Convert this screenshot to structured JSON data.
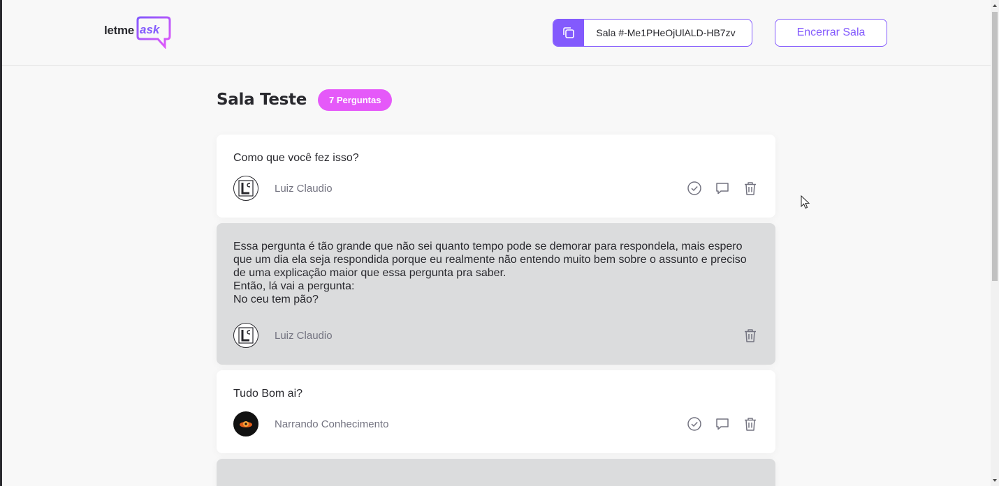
{
  "header": {
    "logo_text_let": "letme",
    "logo_text_ask": "ask",
    "room_code_label": "Sala #-Me1PHeOjUlALD-HB7zv",
    "close_room_label": "Encerrar Sala"
  },
  "room": {
    "title": "Sala Teste",
    "question_count": "7 Perguntas"
  },
  "questions": [
    {
      "text": "Como que você fez isso?",
      "author": "Luiz Claudio",
      "highlighted": false
    },
    {
      "text": "Essa pergunta é tão grande que não sei quanto tempo pode se demorar para respondela, mais espero que um dia ela seja respondida porque eu realmente não entendo muito bem sobre o assunto e preciso de uma explicação maior que essa pergunta pra saber.\nEntão, lá vai a pergunta:\nNo ceu tem pão?",
      "author": "Luiz Claudio",
      "highlighted": true
    },
    {
      "text": "Tudo Bom ai?",
      "author": "Narrando Conhecimento",
      "highlighted": false
    }
  ],
  "colors": {
    "accent": "#835afd",
    "badge": "#e559f9",
    "highlight_bg": "#dbdcdd",
    "muted_text": "#737380"
  },
  "icons": {
    "copy": "copy-icon",
    "check": "check-circle-icon",
    "answer": "answer-bubble-icon",
    "delete": "trash-icon"
  }
}
